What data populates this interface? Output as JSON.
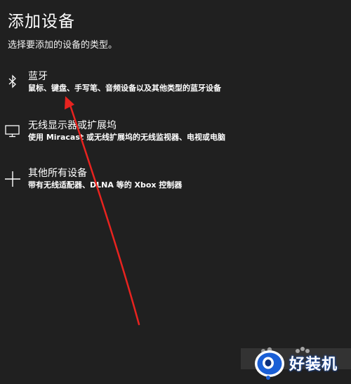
{
  "dialog": {
    "title": "添加设备",
    "subtitle": "选择要添加的设备的类型。"
  },
  "options": [
    {
      "label": "蓝牙",
      "description": "鼠标、键盘、手写笔、音频设备以及其他类型的蓝牙设备",
      "icon": "bluetooth-icon"
    },
    {
      "label": "无线显示器或扩展坞",
      "description": "使用 Miracast 或无线扩展坞的无线监视器、电视或电脑",
      "icon": "monitor-icon"
    },
    {
      "label": "其他所有设备",
      "description": "带有无线适配器、DLNA 等的 Xbox 控制器",
      "icon": "plus-icon"
    }
  ],
  "annotation": {
    "arrow_color": "#e8231f"
  },
  "watermark": {
    "text": "好装机",
    "logo_color": "#1a5fd6"
  }
}
